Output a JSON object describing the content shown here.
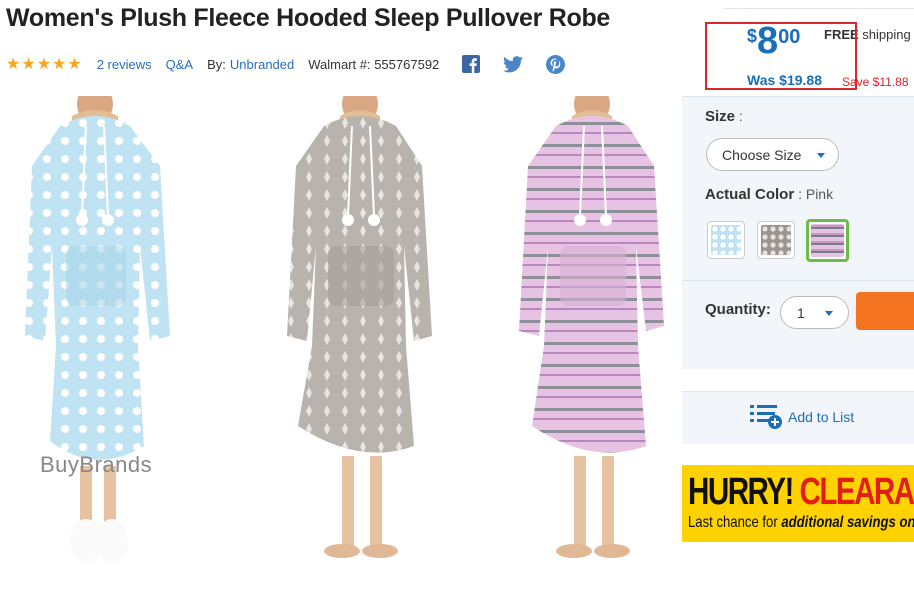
{
  "product": {
    "title": "Women's Plush Fleece Hooded Sleep Pullover Robe",
    "stars": "★★★★★",
    "reviews": "2 reviews",
    "qa": "Q&A",
    "by_label": "By:",
    "brand": "Unbranded",
    "walmart_number": "Walmart #: 555767592"
  },
  "social": [
    "facebook-icon",
    "twitter-icon",
    "pinterest-icon"
  ],
  "images": [
    {
      "name": "blue-snowflake-robe",
      "color": "#bfe3f3",
      "dot": "#ffffff"
    },
    {
      "name": "gray-fairisle-robe",
      "color": "#b9b3ad",
      "dot": "#e8e5e1"
    },
    {
      "name": "pink-fairisle-robe",
      "color": "#e6c3e2",
      "dot": "#8f8f9a"
    }
  ],
  "watermark": "BuyBrands",
  "price": {
    "currency": "$",
    "whole": "8",
    "cents": "00",
    "free": "FREE",
    "shipping": " shipping",
    "was": "Was $19.88",
    "save": "Save $11.88"
  },
  "options": {
    "size_label": "Size",
    "size_sep": " :",
    "size_select": "Choose Size",
    "color_label": "Actual Color",
    "color_sep": " : ",
    "color_value": "Pink",
    "quantity_label": "Quantity:",
    "quantity_value": "1"
  },
  "add_to_list": "Add to List",
  "banner": {
    "hurry": "HURRY!",
    "clearance": " CLEARA",
    "line_a": "Last chance for ",
    "line_b": "additional savings on"
  },
  "colors": {
    "accent": "#1a6fb8",
    "sale_red": "#d8262d",
    "cart_orange": "#f47321",
    "banner_yellow": "#ffd200",
    "selected_green": "#6dbb48"
  }
}
